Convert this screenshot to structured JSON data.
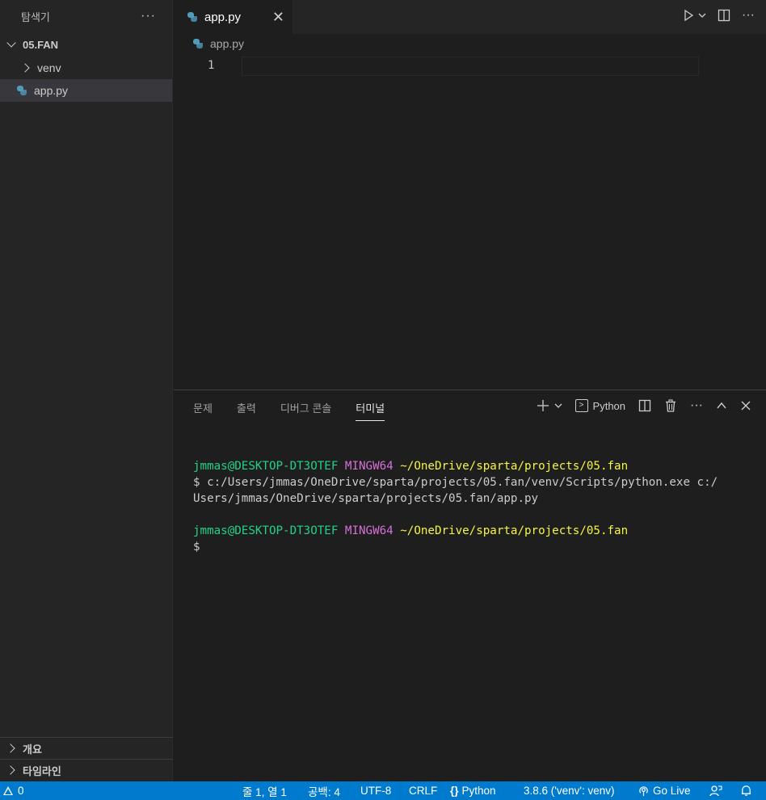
{
  "sidebar": {
    "title": "탐색기",
    "more": "···",
    "folder": "05.FAN",
    "items": [
      {
        "label": "venv",
        "type": "folder"
      },
      {
        "label": "app.py",
        "type": "file"
      }
    ],
    "outline": "개요",
    "timeline": "타임라인"
  },
  "editor": {
    "tab_label": "app.py",
    "breadcrumb": "app.py",
    "line_number": "1"
  },
  "panel": {
    "tabs": [
      "문제",
      "출력",
      "디버그 콘솔",
      "터미널"
    ],
    "active_tab": "터미널",
    "terminal_name": "Python",
    "lines": [
      {
        "user": "jmmas@DESKTOP-DT3OTEF",
        "env": "MINGW64",
        "path": "~/OneDrive/sparta/projects/05.fan"
      },
      {
        "cmd": "$ c:/Users/jmmas/OneDrive/sparta/projects/05.fan/venv/Scripts/python.exe c:/"
      },
      {
        "cmd": "Users/jmmas/OneDrive/sparta/projects/05.fan/app.py"
      },
      {
        "cmd": ""
      },
      {
        "user": "jmmas@DESKTOP-DT3OTEF",
        "env": "MINGW64",
        "path": "~/OneDrive/sparta/projects/05.fan"
      },
      {
        "cmd": "$"
      }
    ]
  },
  "statusbar": {
    "problems": "0",
    "position": "줄 1, 열 1",
    "spaces": "공백: 4",
    "encoding": "UTF-8",
    "eol": "CRLF",
    "language": "Python",
    "interpreter": "3.8.6 ('venv': venv)",
    "golive": "Go Live"
  },
  "colors": {
    "statusbar": "#007acc",
    "terminal_user": "#23d18b",
    "terminal_env": "#d670d6",
    "terminal_path": "#f5f543"
  }
}
